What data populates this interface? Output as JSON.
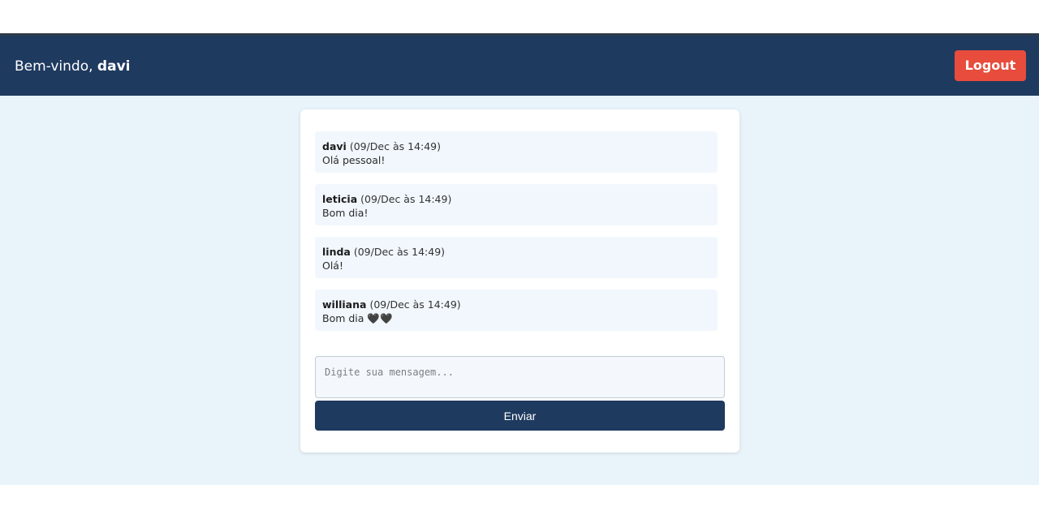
{
  "header": {
    "welcome_prefix": "Bem-vindo,",
    "username": "davi",
    "logout_label": "Logout"
  },
  "chat": {
    "messages": [
      {
        "author": "davi",
        "meta": "(09/Dec às 14:49)",
        "text": "Olá pessoal!"
      },
      {
        "author": "leticia",
        "meta": "(09/Dec às 14:49)",
        "text": "Bom dia!"
      },
      {
        "author": "linda",
        "meta": "(09/Dec às 14:49)",
        "text": "Olá!"
      },
      {
        "author": "williana",
        "meta": "(09/Dec às 14:49)",
        "text": "Bom dia 🖤🖤"
      }
    ],
    "input_placeholder": "Digite sua mensagem...",
    "input_value": "",
    "send_label": "Enviar"
  },
  "colors": {
    "header_bg": "#1f3a5f",
    "logout_bg": "#e74c3c",
    "page_bg": "#e8f3fa",
    "message_bg": "#f1f7fd",
    "send_bg": "#1f3a5f"
  }
}
